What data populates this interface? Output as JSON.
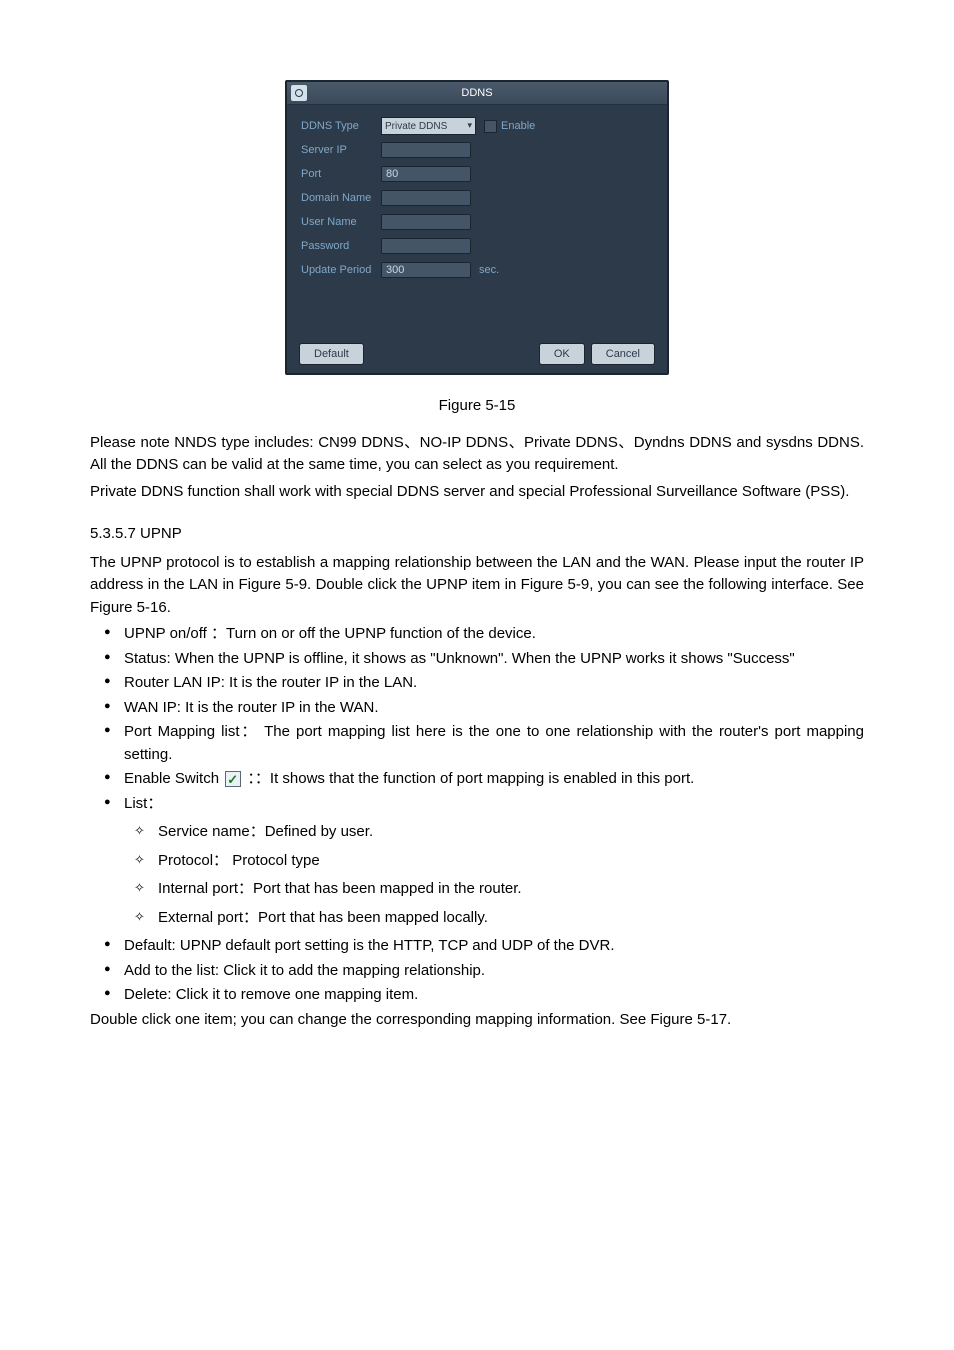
{
  "ddns_panel": {
    "title": "DDNS",
    "rows": {
      "ddns_type_label": "DDNS Type",
      "ddns_type_value": "Private DDNS",
      "enable_label": "Enable",
      "server_ip_label": "Server IP",
      "server_ip_value": "",
      "port_label": "Port",
      "port_value": "80",
      "domain_label": "Domain Name",
      "domain_value": "",
      "user_label": "User Name",
      "user_value": "",
      "password_label": "Password",
      "password_value": "",
      "update_label": "Update Period",
      "update_value": "300",
      "update_unit": "sec."
    },
    "buttons": {
      "default": "Default",
      "ok": "OK",
      "cancel": "Cancel"
    }
  },
  "figure_caption": "Figure 5-15",
  "para1": "Please note NNDS type includes: CN99 DDNS、NO-IP DDNS、Private DDNS、Dyndns DDNS and sysdns DDNS. All the DDNS can be valid at the same time, you can select as you requirement.",
  "para2": "Private DDNS function shall work with special DDNS server and special Professional Surveillance Software (PSS).",
  "section_heading": "5.3.5.7  UPNP",
  "para3": "The UPNP protocol is to establish a mapping relationship between the LAN and the WAN. Please input the router IP address in the LAN in Figure 5-9. Double click the UPNP item in Figure 5-9, you can see the following interface. See Figure 5-16.",
  "bullets": {
    "upnp_onoff": "UPNP   on/off  ：Turn on or off the UPNP function of the device.",
    "status": "Status:   When the UPNP is offline, it shows as \"Unknown\". When the UPNP works it shows \"Success\"",
    "router_lan": "Router LAN IP: It is the router IP in the LAN.",
    "wan_ip": "WAN IP: It is the router IP in the WAN.",
    "port_mapping": "Port Mapping list：  The port mapping list here is the one to one relationship with the router's port mapping setting.",
    "enable_switch_pre": "Enable Switch  ",
    "enable_switch_post": "：：It shows that the function of port mapping is enabled in this port.",
    "list": "List：",
    "default": "Default: UPNP default port setting is the HTTP, TCP and UDP of the DVR.",
    "add": "Add to the list: Click it to add the mapping relationship.",
    "delete": "Delete: Click it to remove one mapping item."
  },
  "diamonds": {
    "service": "Service name：Defined by user.",
    "protocol": "Protocol：  Protocol type",
    "internal": "Internal port：Port that has been mapped in the router.",
    "external": "External port：Port that has been mapped locally."
  },
  "para4": "Double click one item; you can change the corresponding mapping information. See Figure 5-17."
}
